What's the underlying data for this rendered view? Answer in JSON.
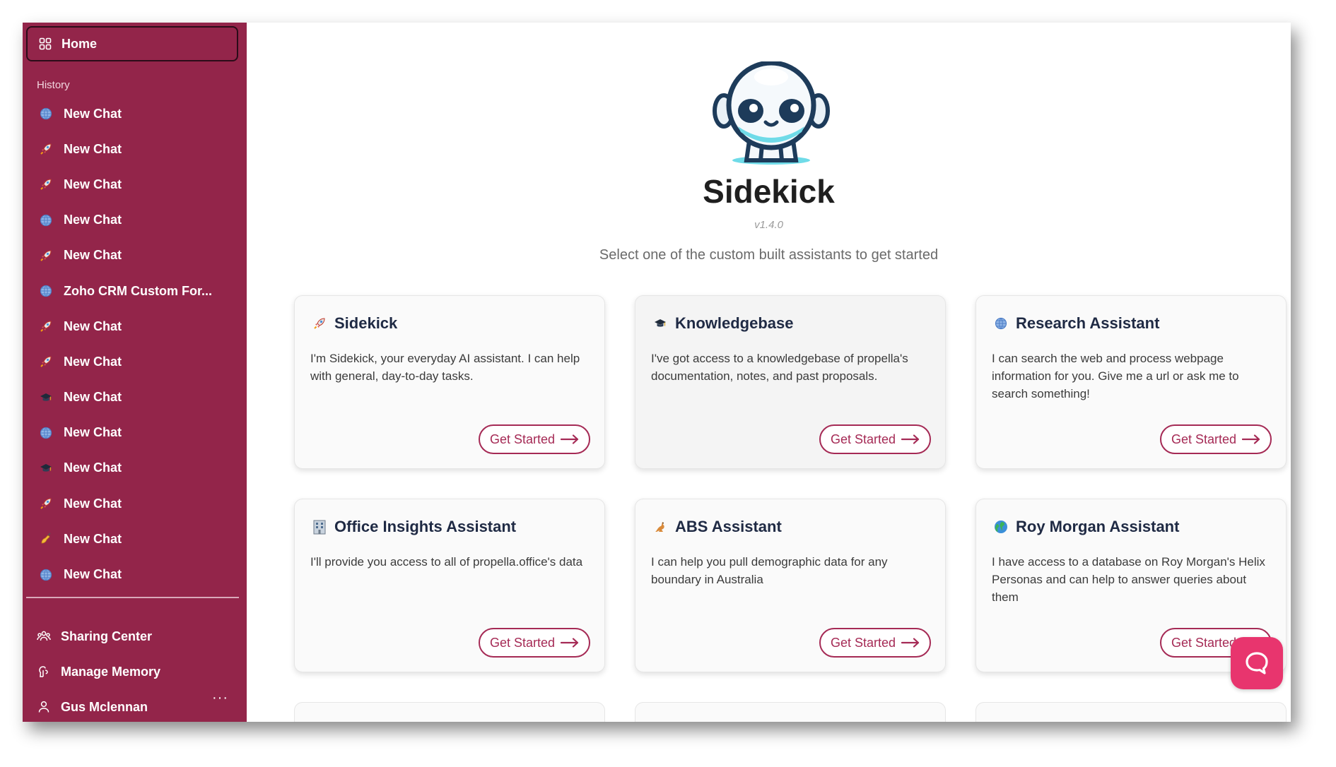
{
  "sidebar": {
    "home_label": "Home",
    "history_label": "History",
    "history": [
      {
        "icon": "globe-icon",
        "label": "New Chat"
      },
      {
        "icon": "rocket-icon",
        "label": "New Chat"
      },
      {
        "icon": "rocket-icon",
        "label": "New Chat"
      },
      {
        "icon": "globe-icon",
        "label": "New Chat"
      },
      {
        "icon": "rocket-icon",
        "label": "New Chat"
      },
      {
        "icon": "globe-icon",
        "label": "Zoho CRM Custom For..."
      },
      {
        "icon": "rocket-icon",
        "label": "New Chat"
      },
      {
        "icon": "rocket-icon",
        "label": "New Chat"
      },
      {
        "icon": "graduation-cap-icon",
        "label": "New Chat"
      },
      {
        "icon": "globe-icon",
        "label": "New Chat"
      },
      {
        "icon": "graduation-cap-icon",
        "label": "New Chat"
      },
      {
        "icon": "rocket-icon",
        "label": "New Chat"
      },
      {
        "icon": "writing-hand-icon",
        "label": "New Chat"
      },
      {
        "icon": "globe-icon",
        "label": "New Chat"
      }
    ],
    "sharing_center": "Sharing Center",
    "manage_memory": "Manage Memory",
    "user_name": "Gus Mclennan",
    "more": "···"
  },
  "main": {
    "title": "Sidekick",
    "version": "v1.4.0",
    "subtitle": "Select one of the custom built assistants to get started",
    "cards": [
      {
        "icon": "rocket-icon",
        "title": "Sidekick",
        "description": "I'm Sidekick, your everyday AI assistant. I can help with general, day-to-day tasks.",
        "cta": "Get Started"
      },
      {
        "icon": "graduation-cap-icon",
        "title": "Knowledgebase",
        "description": "I've got access to a knowledgebase of propella's documentation, notes, and past proposals.",
        "cta": "Get Started"
      },
      {
        "icon": "globe-icon",
        "title": "Research Assistant",
        "description": "I can search the web and process webpage information for you. Give me a url or ask me to search something!",
        "cta": "Get Started"
      },
      {
        "icon": "office-building-icon",
        "title": "Office Insights Assistant",
        "description": "I'll provide you access to all of propella.office's data",
        "cta": "Get Started"
      },
      {
        "icon": "kangaroo-icon",
        "title": "ABS Assistant",
        "description": "I can help you pull demographic data for any boundary in Australia",
        "cta": "Get Started"
      },
      {
        "icon": "earth-globe-icon",
        "title": "Roy Morgan Assistant",
        "description": "I have access to a database on Roy Morgan's Helix Personas and can help to answer queries about them",
        "cta": "Get Started"
      }
    ]
  },
  "colors": {
    "sidebar_bg": "#93254a",
    "accent": "#a52a55",
    "chat_bubble": "#e8356e"
  }
}
